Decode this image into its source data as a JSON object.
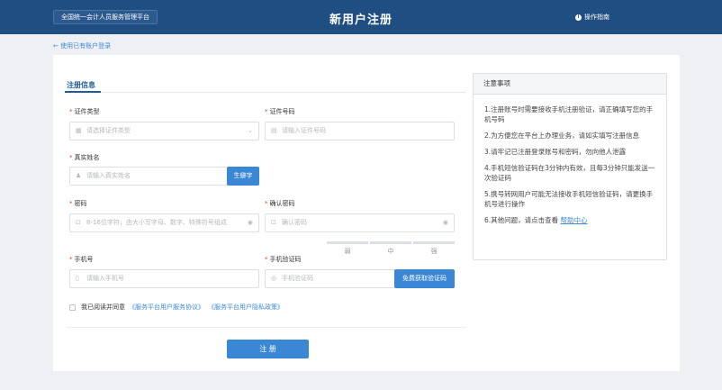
{
  "header": {
    "platform_badge": "全国统一会计人员服务管理平台",
    "title": "新用户注册",
    "guide_label": "操作指南"
  },
  "back_link": "← 使用已有账户登录",
  "tab": {
    "label": "注册信息"
  },
  "form": {
    "id_type": {
      "label": "证件类型",
      "placeholder": "请选择证件类型"
    },
    "id_number": {
      "label": "证件号码",
      "placeholder": "请输入证件号码"
    },
    "real_name": {
      "label": "真实姓名",
      "placeholder": "请输入真实姓名",
      "button": "生僻字"
    },
    "password": {
      "label": "密码",
      "placeholder": "8-16位字符，由大小写字母、数字、特殊符号组成"
    },
    "confirm_password": {
      "label": "确认密码",
      "placeholder": "确认密码"
    },
    "strength": [
      "弱",
      "中",
      "强"
    ],
    "phone": {
      "label": "手机号",
      "placeholder": "请输入手机号"
    },
    "sms_code": {
      "label": "手机验证码",
      "placeholder": "手机验证码",
      "button": "免费获取验证码"
    },
    "agree": {
      "text": "我已阅读并同意",
      "link1": "《服务平台用户服务协议》",
      "link2": "《服务平台用户隐私政策》"
    },
    "submit": "注 册"
  },
  "notice": {
    "title": "注意事项",
    "items": [
      "1.注册账号时需要接收手机注册验证，请正确填写您的手机号码",
      "2.为方便您在平台上办理业务，请如实填写注册信息",
      "3.请牢记已注册登录账号和密码，勿向他人泄露",
      "4.手机短信验证码在3分钟内有效，且每3分钟只能发送一次验证码",
      "5.携号转网用户可能无法接收手机短信验证码，请更换手机号进行操作"
    ],
    "last_prefix": "6.其他问题，请点击查看 ",
    "last_link": "帮助中心"
  }
}
